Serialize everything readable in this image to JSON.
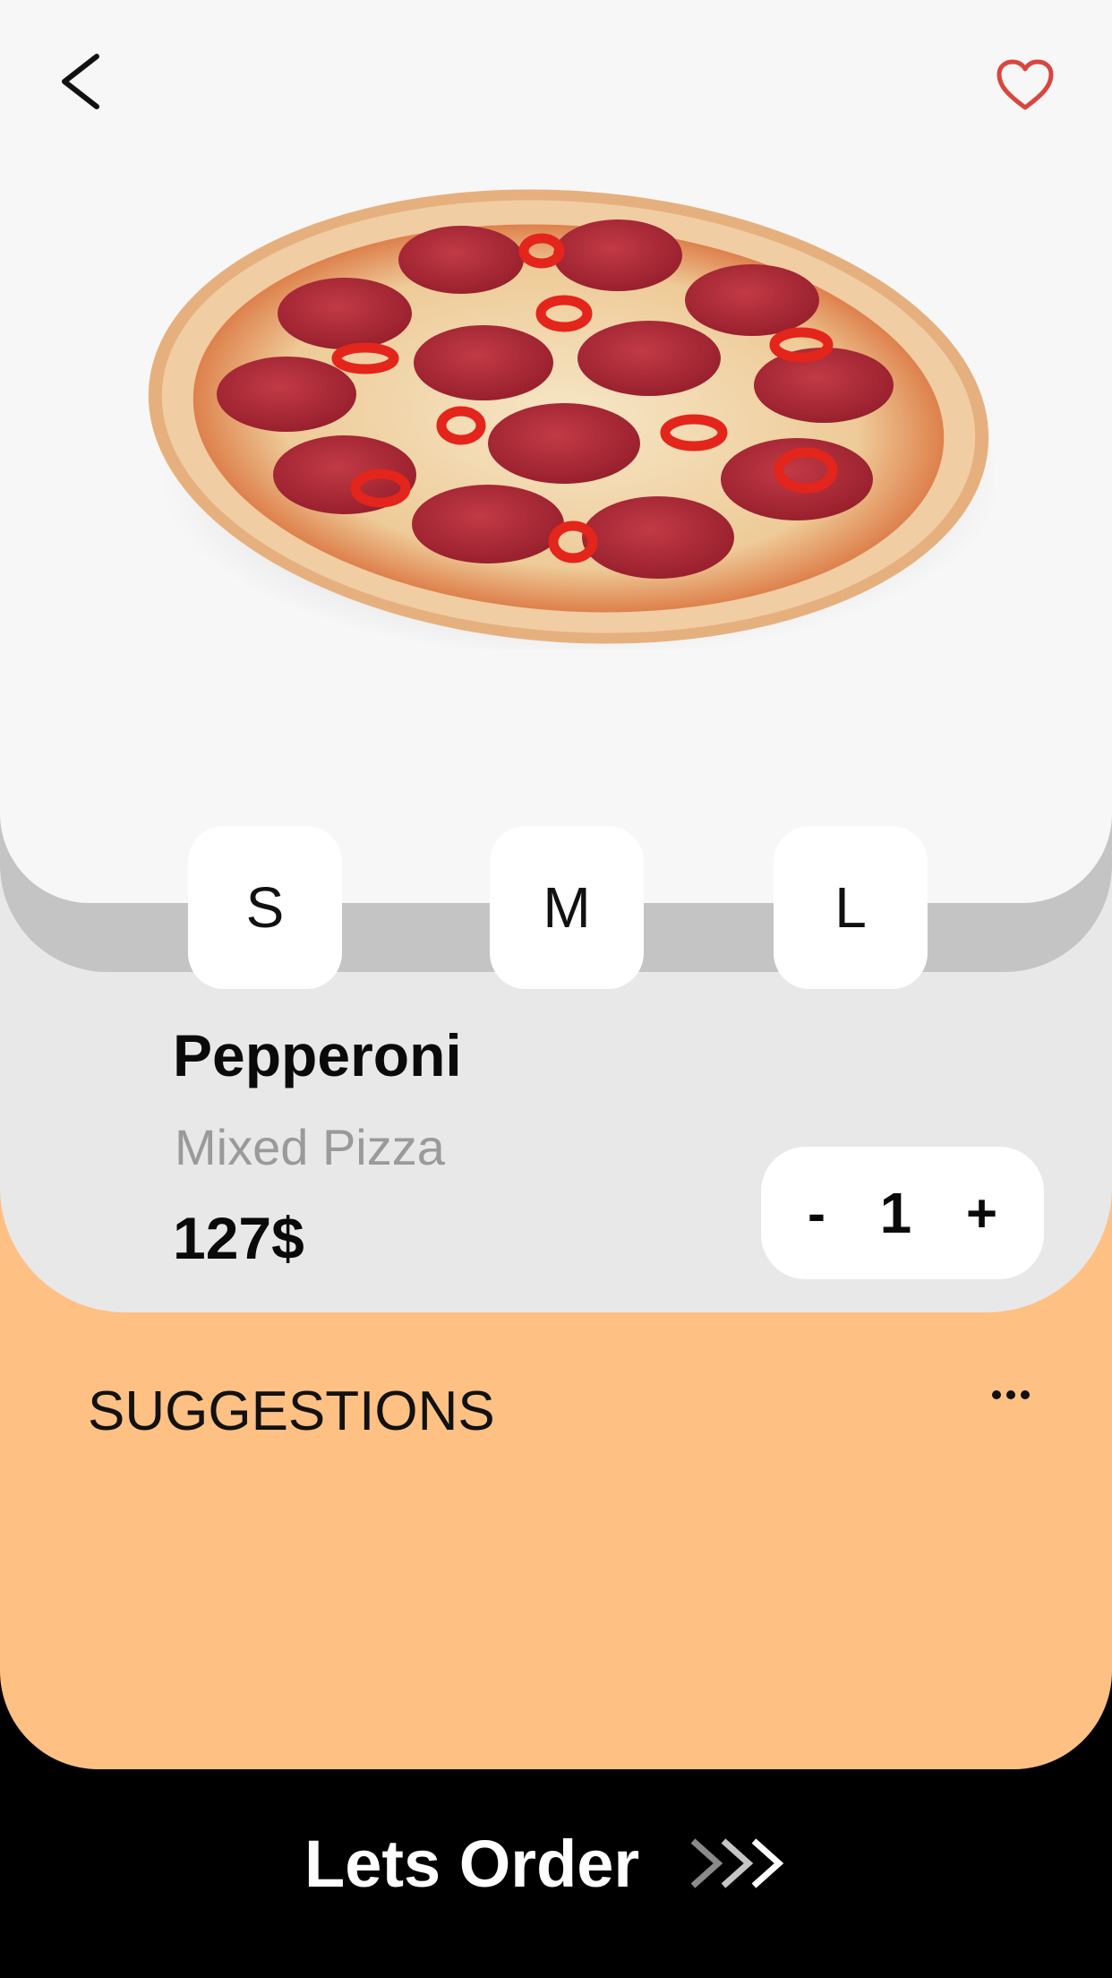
{
  "header": {
    "back_icon": "chevron-left-icon",
    "favorite_icon": "heart-outline-icon",
    "favorite_color": "#d9463f"
  },
  "sizes": [
    {
      "label": "S"
    },
    {
      "label": "M"
    },
    {
      "label": "L"
    }
  ],
  "product": {
    "name": "Pepperoni",
    "category": "Mixed Pizza",
    "price": "127$"
  },
  "stepper": {
    "minus_label": "-",
    "quantity": "1",
    "plus_label": "+"
  },
  "suggestions": {
    "title": "SUGGESTIONS",
    "more_icon": "more-horizontal-icon"
  },
  "order": {
    "label": "Lets Order",
    "arrow_icon": "triple-chevron-right-icon"
  },
  "colors": {
    "accent": "#ffc084",
    "order_bar": "#000000",
    "hero_bg": "#f7f7f7",
    "info_bg": "#e8e8e8"
  }
}
